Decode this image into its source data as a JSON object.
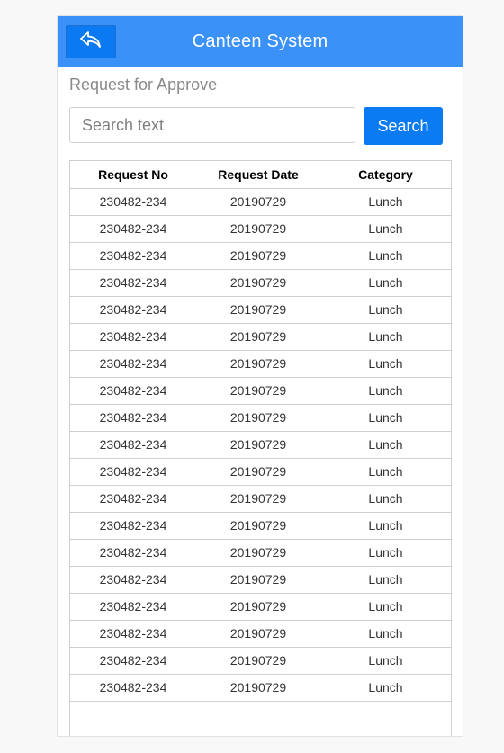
{
  "header": {
    "title": "Canteen System",
    "back_icon": "reply-arrow-icon",
    "color": "#3a91f7"
  },
  "page": {
    "subtitle": "Request for Approve"
  },
  "search": {
    "placeholder": "Search text",
    "value": "",
    "button_label": "Search",
    "button_color": "#0b7bf3"
  },
  "table": {
    "columns": [
      "Request No",
      "Request Date",
      "Category"
    ],
    "rows": [
      [
        "230482-234",
        "20190729",
        "Lunch"
      ],
      [
        "230482-234",
        "20190729",
        "Lunch"
      ],
      [
        "230482-234",
        "20190729",
        "Lunch"
      ],
      [
        "230482-234",
        "20190729",
        "Lunch"
      ],
      [
        "230482-234",
        "20190729",
        "Lunch"
      ],
      [
        "230482-234",
        "20190729",
        "Lunch"
      ],
      [
        "230482-234",
        "20190729",
        "Lunch"
      ],
      [
        "230482-234",
        "20190729",
        "Lunch"
      ],
      [
        "230482-234",
        "20190729",
        "Lunch"
      ],
      [
        "230482-234",
        "20190729",
        "Lunch"
      ],
      [
        "230482-234",
        "20190729",
        "Lunch"
      ],
      [
        "230482-234",
        "20190729",
        "Lunch"
      ],
      [
        "230482-234",
        "20190729",
        "Lunch"
      ],
      [
        "230482-234",
        "20190729",
        "Lunch"
      ],
      [
        "230482-234",
        "20190729",
        "Lunch"
      ],
      [
        "230482-234",
        "20190729",
        "Lunch"
      ],
      [
        "230482-234",
        "20190729",
        "Lunch"
      ],
      [
        "230482-234",
        "20190729",
        "Lunch"
      ],
      [
        "230482-234",
        "20190729",
        "Lunch"
      ]
    ]
  }
}
